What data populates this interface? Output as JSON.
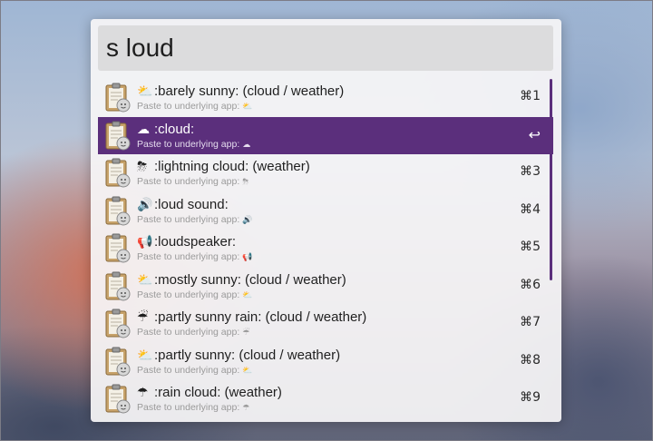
{
  "search": {
    "query": "s loud"
  },
  "results": [
    {
      "emoji": "⛅",
      "title": ":barely sunny: (cloud / weather)",
      "subtitle": "Paste to underlying app:",
      "sub_emoji": "⛅",
      "shortcut": "⌘1",
      "selected": false
    },
    {
      "emoji": "☁",
      "title": ":cloud:",
      "subtitle": "Paste to underlying app:",
      "sub_emoji": "☁",
      "shortcut": "↩",
      "selected": true
    },
    {
      "emoji": "⛈",
      "title": ":lightning cloud: (weather)",
      "subtitle": "Paste to underlying app:",
      "sub_emoji": "⛈",
      "shortcut": "⌘3",
      "selected": false
    },
    {
      "emoji": "🔊",
      "title": ":loud sound:",
      "subtitle": "Paste to underlying app:",
      "sub_emoji": "🔊",
      "shortcut": "⌘4",
      "selected": false
    },
    {
      "emoji": "📢",
      "title": ":loudspeaker:",
      "subtitle": "Paste to underlying app:",
      "sub_emoji": "📢",
      "shortcut": "⌘5",
      "selected": false
    },
    {
      "emoji": "⛅",
      "title": ":mostly sunny: (cloud / weather)",
      "subtitle": "Paste to underlying app:",
      "sub_emoji": "⛅",
      "shortcut": "⌘6",
      "selected": false
    },
    {
      "emoji": "☔",
      "title": ":partly sunny rain: (cloud / weather)",
      "subtitle": "Paste to underlying app:",
      "sub_emoji": "☔",
      "shortcut": "⌘7",
      "selected": false
    },
    {
      "emoji": "⛅",
      "title": ":partly sunny: (cloud / weather)",
      "subtitle": "Paste to underlying app:",
      "sub_emoji": "⛅",
      "shortcut": "⌘8",
      "selected": false
    },
    {
      "emoji": "☂",
      "title": ":rain cloud: (weather)",
      "subtitle": "Paste to underlying app:",
      "sub_emoji": "☂",
      "shortcut": "⌘9",
      "selected": false
    }
  ],
  "theme": {
    "selected_row": "#5b2f7c",
    "scrollbar": "#5b2f7c"
  },
  "icons": {
    "row_icon": "clipboard-icon"
  }
}
